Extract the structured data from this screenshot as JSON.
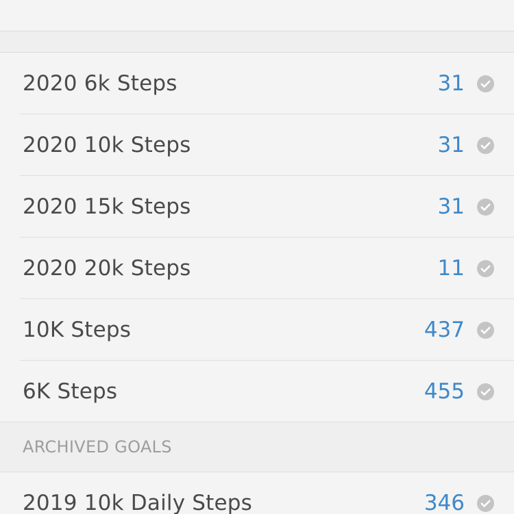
{
  "goals": [
    {
      "label": "2020 6k Steps",
      "count": "31"
    },
    {
      "label": "2020 10k Steps",
      "count": "31"
    },
    {
      "label": "2020 15k Steps",
      "count": "31"
    },
    {
      "label": "2020 20k Steps",
      "count": "11"
    },
    {
      "label": "10K Steps",
      "count": "437"
    },
    {
      "label": "6K Steps",
      "count": "455"
    }
  ],
  "archived": {
    "title": "ARCHIVED GOALS",
    "goals": [
      {
        "label": "2019 10k Daily Steps",
        "count": "346"
      }
    ]
  },
  "icons": {
    "row_status": "checkmark-circle-icon"
  },
  "colors": {
    "count": "#3f88c9",
    "check": "#c4c4c4"
  }
}
